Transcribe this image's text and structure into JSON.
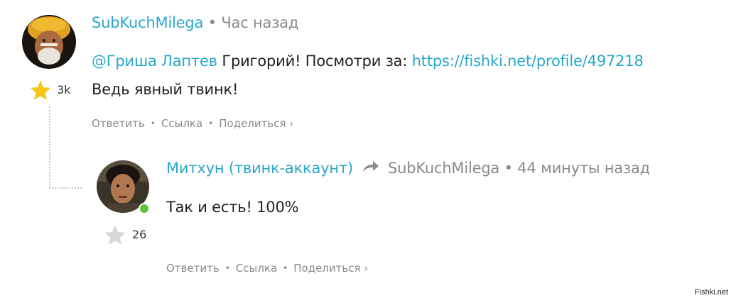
{
  "comment1": {
    "author": "SubKuchMilega",
    "time": "Час назад",
    "mention": "@Гриша Лаптев",
    "text_after_mention": " Григорий! Посмотри за: ",
    "url": "https://fishki.net/profile/497218",
    "line2": "Ведь явный твинк!",
    "rating": "3k",
    "actions": {
      "reply": "Ответить",
      "link": "Ссылка",
      "share": "Поделиться ›"
    }
  },
  "comment2": {
    "author": "Митхун (твинк-аккаунт)",
    "reply_to": "SubKuchMilega",
    "time": "44 минуты назад",
    "text": "Так и есть! 100%",
    "rating": "26",
    "actions": {
      "reply": "Ответить",
      "link": "Ссылка",
      "share": "Поделиться ›"
    }
  },
  "separator": "•",
  "watermark": "Fishki.net",
  "colors": {
    "accent": "#2aa7c9",
    "meta": "#8a8a8a",
    "star_active": "#f5c518",
    "star_inactive": "#d6d6d6",
    "online": "#5ec23a"
  },
  "icons": {
    "star_active": "star-icon",
    "star_inactive": "star-outline-icon",
    "reply_arrow": "reply-arrow-icon"
  }
}
